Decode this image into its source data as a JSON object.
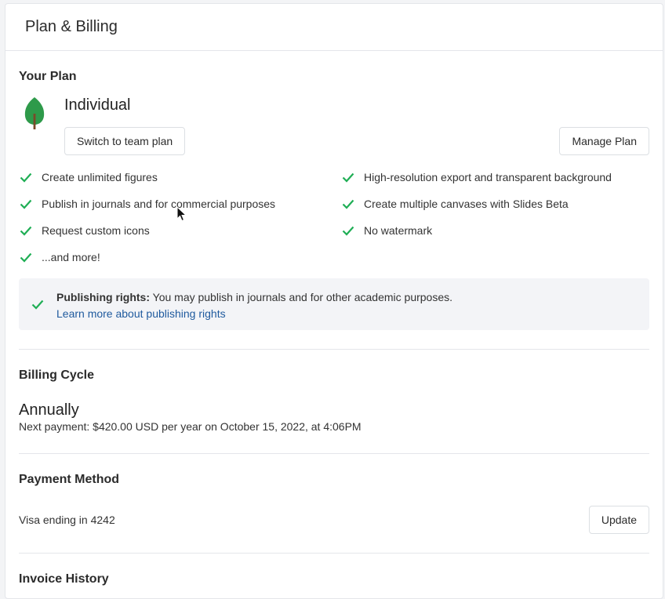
{
  "header": {
    "title": "Plan & Billing"
  },
  "plan": {
    "section_title": "Your Plan",
    "name": "Individual",
    "switch_label": "Switch to team plan",
    "manage_label": "Manage Plan",
    "icon": "tree-icon",
    "features_left": [
      "Create unlimited figures",
      "Publish in journals and for commercial purposes",
      "Request custom icons",
      "...and more!"
    ],
    "features_right": [
      "High-resolution export and transparent background",
      "Create multiple canvases with Slides Beta",
      "No watermark"
    ],
    "rights": {
      "label": "Publishing rights:",
      "text": " You may publish in journals and for other academic purposes.",
      "link": "Learn more about publishing rights"
    }
  },
  "billing": {
    "section_title": "Billing Cycle",
    "cycle": "Annually",
    "next_payment": "Next payment: $420.00 USD per year on October 15, 2022, at 4:06PM"
  },
  "payment": {
    "section_title": "Payment Method",
    "card": "Visa ending in 4242",
    "update_label": "Update"
  },
  "invoice": {
    "section_title": "Invoice History"
  },
  "colors": {
    "check": "#1fae55",
    "link": "#1f5a9e",
    "leaf": "#2e9a4a",
    "trunk": "#7a4a2a"
  }
}
